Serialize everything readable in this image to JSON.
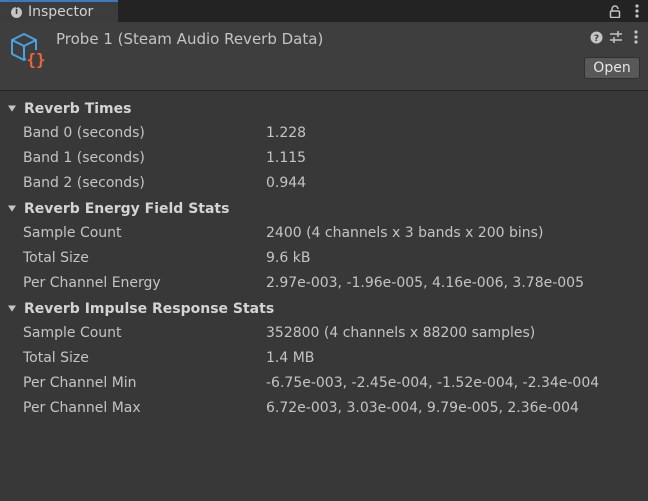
{
  "tab": {
    "title": "Inspector"
  },
  "header": {
    "title": "Probe 1 (Steam Audio Reverb Data)",
    "open_label": "Open",
    "icon": "reverb-data-asset-icon",
    "icon_colors": {
      "cube": "#4aa3df",
      "braces": "#f0663c"
    }
  },
  "sections": [
    {
      "title": "Reverb Times",
      "rows": [
        {
          "label": "Band 0 (seconds)",
          "value": "1.228"
        },
        {
          "label": "Band 1 (seconds)",
          "value": "1.115"
        },
        {
          "label": "Band 2 (seconds)",
          "value": "0.944"
        }
      ]
    },
    {
      "title": "Reverb Energy Field Stats",
      "rows": [
        {
          "label": "Sample Count",
          "value": "2400 (4 channels x 3 bands x 200 bins)"
        },
        {
          "label": "Total Size",
          "value": "9.6 kB"
        },
        {
          "label": "Per Channel Energy",
          "value": "2.97e-003, -1.96e-005, 4.16e-006, 3.78e-005"
        }
      ]
    },
    {
      "title": "Reverb Impulse Response Stats",
      "rows": [
        {
          "label": "Sample Count",
          "value": "352800 (4 channels x 88200 samples)"
        },
        {
          "label": "Total Size",
          "value": "1.4 MB"
        },
        {
          "label": "Per Channel Min",
          "value": "-6.75e-003, -2.45e-004, -1.52e-004, -2.34e-004"
        },
        {
          "label": "Per Channel Max",
          "value": "6.72e-003, 3.03e-004, 9.79e-005, 2.36e-004"
        }
      ]
    }
  ],
  "colors": {
    "panel": "#383838",
    "tabbar": "#232323",
    "tab_active_accent": "#3a79bb",
    "text": "#c4c4c4"
  }
}
